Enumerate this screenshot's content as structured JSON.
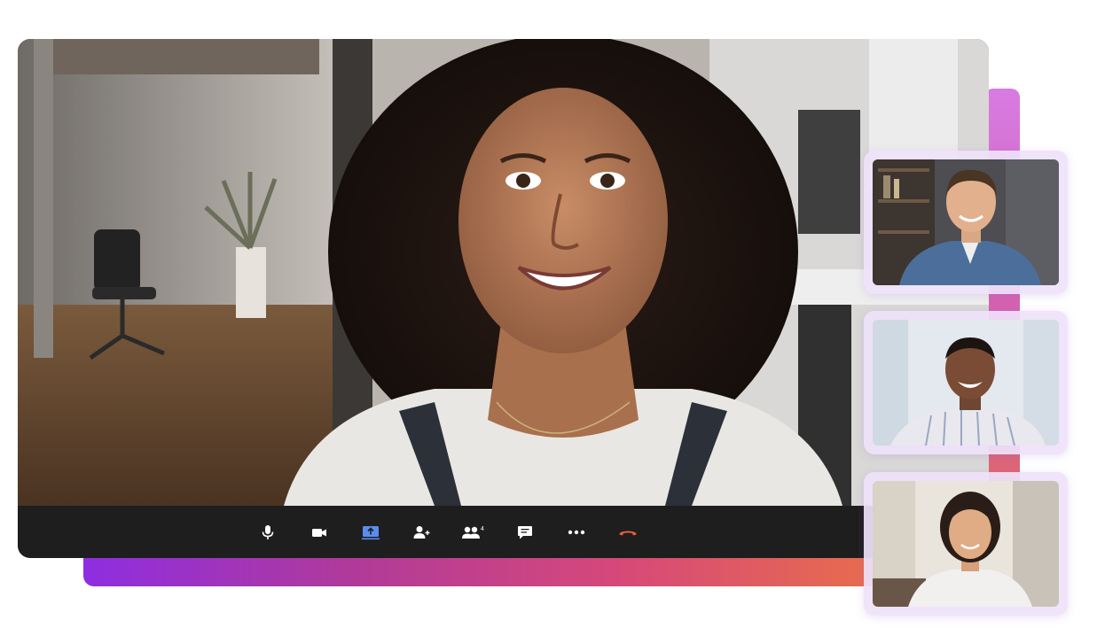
{
  "app": {
    "accent_colors": [
      "#8e2de2",
      "#d6487a",
      "#ee7a3c"
    ]
  },
  "main_video": {
    "participant": "main-speaker",
    "background": "office"
  },
  "control_bar": {
    "buttons": [
      {
        "name": "microphone",
        "icon": "microphone-icon"
      },
      {
        "name": "camera",
        "icon": "video-camera-icon"
      },
      {
        "name": "share-screen",
        "icon": "share-screen-icon",
        "active": true,
        "color": "#5b8def"
      },
      {
        "name": "add-participant",
        "icon": "add-person-icon"
      },
      {
        "name": "participants",
        "icon": "people-icon",
        "badge": "4"
      },
      {
        "name": "chat",
        "icon": "chat-bubble-icon"
      },
      {
        "name": "more",
        "icon": "more-dots-icon"
      },
      {
        "name": "end-call",
        "icon": "hang-up-icon",
        "color": "#e8603c"
      }
    ]
  },
  "participant_tiles": [
    {
      "participant": "participant-1"
    },
    {
      "participant": "participant-2"
    },
    {
      "participant": "participant-3"
    }
  ]
}
